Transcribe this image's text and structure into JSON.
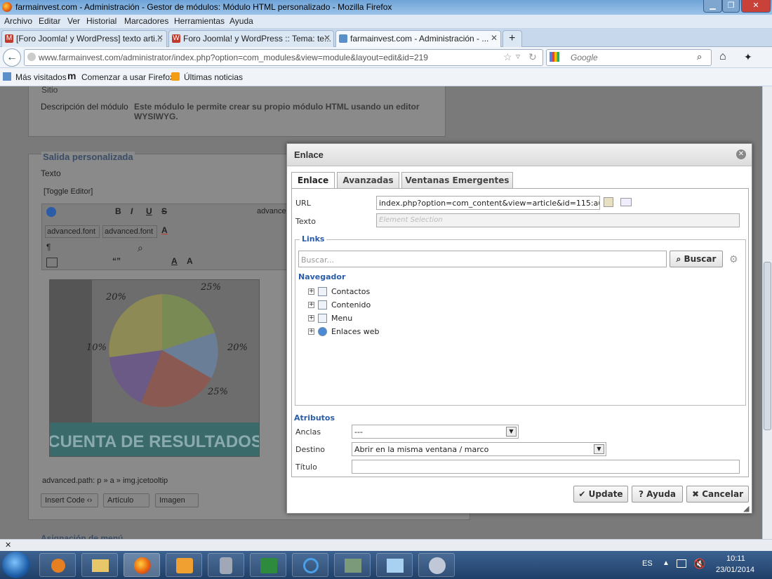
{
  "window": {
    "title": "farmainvest.com - Administración - Gestor de módulos: Módulo HTML personalizado - Mozilla Firefox"
  },
  "menu": [
    "Archivo",
    "Editar",
    "Ver",
    "Historial",
    "Marcadores",
    "Herramientas",
    "Ayuda"
  ],
  "tabs": [
    {
      "label": "[Foro Joomla! y WordPress] texto arti..."
    },
    {
      "label": "Foro Joomla! y WordPress :: Tema: te..."
    },
    {
      "label": "farmainvest.com - Administración - ..."
    }
  ],
  "address": {
    "url": "www.farmainvest.com/administrator/index.php?option=com_modules&view=module&layout=edit&id=219",
    "search_placeholder": "Google"
  },
  "bookmarks": [
    "Más visitados",
    "Comenzar a usar Firefox",
    "Últimas noticias"
  ],
  "page": {
    "sitio": "Sitio",
    "desc_label": "Descripción del módulo",
    "desc_text": "Este módulo le permite crear su propio módulo HTML usando un editor WYSIWYG.",
    "section": "Salida personalizada",
    "texto": "Texto",
    "toggle": "[Toggle Editor]",
    "font1": "advanced.font",
    "font2": "advanced.font",
    "advance": "advance",
    "path": "advanced.path:  p » a » img.jcetooltip",
    "btn_insert": "Insert Code",
    "btn_article": "Artículo",
    "btn_image": "Imagen",
    "image_text": "CUENTA DE RESULTADOS",
    "image_pcts": [
      "20%",
      "25%",
      "10%",
      "20%",
      "25%"
    ],
    "next_section": "Asignación de menú"
  },
  "dialog": {
    "title": "Enlace",
    "tabs": [
      "Enlace",
      "Avanzadas",
      "Ventanas Emergentes"
    ],
    "url_label": "URL",
    "url_value": "index.php?option=com_content&view=article&id=115:audito",
    "texto_label": "Texto",
    "texto_placeholder": "Element Selection",
    "links_section": "Links",
    "search_placeholder": "Buscar...",
    "search_button": "Buscar",
    "navigator": "Navegador",
    "tree": [
      "Contactos",
      "Contenido",
      "Menu",
      "Enlaces web"
    ],
    "attributes": "Atributos",
    "anclas_label": "Anclas",
    "anclas_value": "---",
    "destino_label": "Destino",
    "destino_value": "Abrir en la misma ventana / marco",
    "titulo_label": "Título",
    "btn_update": "Update",
    "btn_help": "Ayuda",
    "btn_cancel": "Cancelar"
  },
  "taskbar": {
    "lang": "ES",
    "time": "10:11",
    "date": "23/01/2014"
  }
}
